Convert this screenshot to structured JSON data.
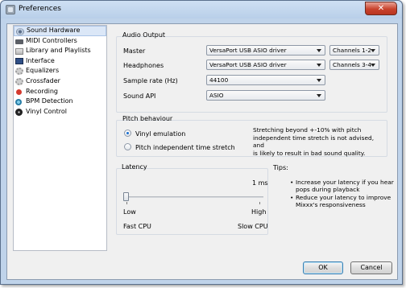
{
  "window": {
    "title": "Preferences",
    "close_glyph": "✕"
  },
  "sidebar": {
    "items": [
      {
        "label": "Sound Hardware",
        "icon": "speaker-icon"
      },
      {
        "label": "MIDI Controllers",
        "icon": "keyboard-icon"
      },
      {
        "label": "Library and Playlists",
        "icon": "library-icon"
      },
      {
        "label": "Interface",
        "icon": "monitor-icon"
      },
      {
        "label": "Equalizers",
        "icon": "equalizer-icon"
      },
      {
        "label": "Crossfader",
        "icon": "crossfader-icon"
      },
      {
        "label": "Recording",
        "icon": "record-icon"
      },
      {
        "label": "BPM Detection",
        "icon": "bpm-icon"
      },
      {
        "label": "Vinyl Control",
        "icon": "vinyl-icon"
      }
    ]
  },
  "audio_output": {
    "title": "Audio Output",
    "master_label": "Master",
    "master_device": "VersaPort USB ASIO driver",
    "master_channels": "Channels 1-2",
    "headphones_label": "Headphones",
    "headphones_device": "VersaPort USB ASIO driver",
    "headphones_channels": "Channels 3-4",
    "sample_rate_label": "Sample rate (Hz)",
    "sample_rate_value": "44100",
    "sound_api_label": "Sound API",
    "sound_api_value": "ASIO"
  },
  "pitch": {
    "title": "Pitch behaviour",
    "options": [
      "Vinyl emulation",
      "Pitch independent time stretch"
    ],
    "selected": "Vinyl emulation",
    "note_lines": [
      "Stretching beyond +-10% with pitch",
      "independent time stretch is not advised, and",
      "is likely to result in bad sound quality."
    ]
  },
  "latency": {
    "title": "Latency",
    "value_text": "1 ms",
    "level": 0,
    "low_label": "Low",
    "high_label": "High",
    "fast_label": "Fast CPU",
    "slow_label": "Slow CPU"
  },
  "tips": {
    "title": "Tips:",
    "items": [
      {
        "line1": "Increase your latency if you hear",
        "line2": "pops during playback"
      },
      {
        "line1": "Reduce your latency to improve",
        "line2": "Mixxx's responsiveness"
      }
    ]
  },
  "buttons": {
    "ok": "OK",
    "cancel": "Cancel"
  }
}
